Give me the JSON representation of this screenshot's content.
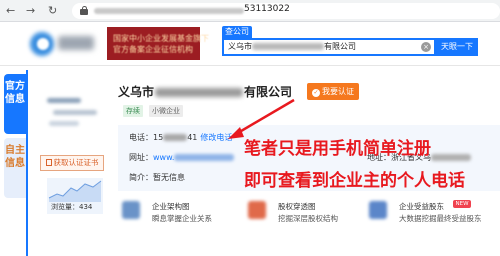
{
  "browser": {
    "back": "←",
    "forward": "→",
    "reload": "↻",
    "url_suffix": "53113022"
  },
  "header": {
    "banner_line1": "国家中小企业发展基金旗下",
    "banner_line2": "官方备案企业征信机构",
    "search_tab": "查公司",
    "search_prefix": "义乌市",
    "search_suffix": "有限公司",
    "search_button": "天眼一下",
    "clear": "×"
  },
  "side_tabs": {
    "active": "官方信息",
    "inactive": "自主信息"
  },
  "company": {
    "name_prefix": "义乌市",
    "name_suffix": "有限公司",
    "verify_label": "我要认证",
    "tags": [
      "存续",
      "小微企业"
    ],
    "cert_button": "获取认证证书",
    "views_label": "浏览量：434",
    "phone_label": "电话：15",
    "phone_tail": "41",
    "edit_phone": "修改电话",
    "website_label": "网址：",
    "website_prefix": "www.",
    "address_label": "地址：浙江省义乌",
    "intro_label": "简介：暂无信息"
  },
  "annotation": {
    "line1": "笔者只是用手机简单注册",
    "line2": "即可查看到企业主的个人电话",
    "color": "#e8191f"
  },
  "features": [
    {
      "title": "企业架构图",
      "subtitle": "瞬息掌握企业关系",
      "icon_color": "#6a93c8"
    },
    {
      "title": "股权穿透图",
      "subtitle": "挖掘深层股权结构",
      "icon_color": "#e06a4a"
    },
    {
      "title": "企业受益股东",
      "subtitle": "大数据挖掘最终受益股东",
      "icon_color": "#5b86c9",
      "badge": "NEW"
    }
  ],
  "colors": {
    "accent": "#1677ff",
    "brand_red": "#9c1d22",
    "orange": "#f5781e"
  }
}
